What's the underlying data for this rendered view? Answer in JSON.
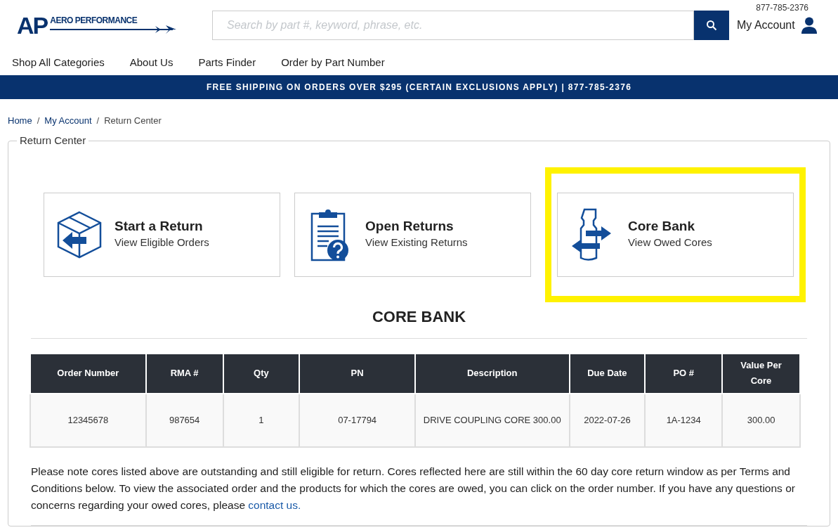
{
  "header": {
    "logo": {
      "mark": "AP",
      "name": "AERO PERFORMANCE"
    },
    "search": {
      "placeholder": "Search by part #, keyword, phrase, etc."
    },
    "phone": "877-785-2376",
    "account": "My Account"
  },
  "nav": [
    "Shop All Categories",
    "About Us",
    "Parts Finder",
    "Order by Part Number"
  ],
  "banner": "FREE SHIPPING ON ORDERS OVER $295 (CERTAIN EXCLUSIONS APPLY) | 877-785-2376",
  "breadcrumb": [
    {
      "kind": "link",
      "label": "Home"
    },
    {
      "kind": "separator",
      "label": "/"
    },
    {
      "kind": "link",
      "label": "My Account"
    },
    {
      "kind": "separator",
      "label": "/"
    },
    {
      "kind": "current",
      "label": "Return Center"
    }
  ],
  "panel": {
    "legend": "Return Center",
    "cards": [
      {
        "kind": "box",
        "title": "Start a Return",
        "subtitle": "View Eligible Orders",
        "highlighted": false
      },
      {
        "kind": "clipboard",
        "title": "Open Returns",
        "subtitle": "View Existing Returns",
        "highlighted": false
      },
      {
        "kind": "core",
        "title": "Core Bank",
        "subtitle": "View Owed Cores",
        "highlighted": true
      }
    ],
    "heading": "CORE BANK",
    "table": {
      "columns": [
        "Order Number",
        "RMA #",
        "Qty",
        "PN",
        "Description",
        "Due Date",
        "PO #",
        "Value Per Core"
      ],
      "rows": [
        [
          "12345678",
          "987654",
          "1",
          "07-17794",
          "DRIVE COUPLING CORE 300.00",
          "2022-07-26",
          "1A-1234",
          "300.00"
        ]
      ]
    },
    "note": {
      "text": "Please note cores listed above are outstanding and still eligible for return. Cores reflected here are still within the 60 day core return window as per Terms and Conditions below. To view the associated order and the products for which the cores are owed, you can click on the order number. If you have any questions or concerns regarding your owed cores, please",
      "link": "contact us."
    }
  }
}
